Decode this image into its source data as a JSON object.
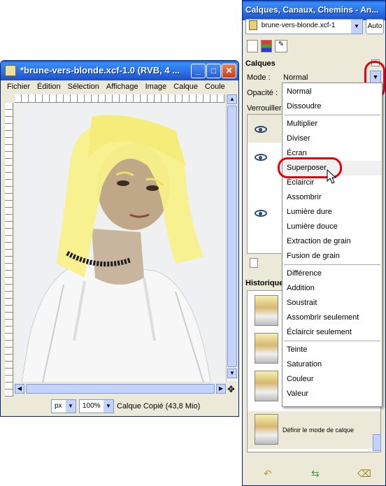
{
  "image_window": {
    "title": "*brune-vers-blonde.xcf-1.0 (RVB, 4 ...",
    "menu": [
      "Fichier",
      "Édition",
      "Sélection",
      "Affichage",
      "Image",
      "Calque",
      "Coule"
    ],
    "status": {
      "unit": "px",
      "zoom": "100%",
      "layer_info": "Calque Copié (43,8 Mio)"
    }
  },
  "dock": {
    "title": "Calques, Canaux, Chemins - An...",
    "image_select": "brune-vers-blonde.xcf-1",
    "auto_label": "Auto",
    "layers": {
      "heading": "Calques",
      "mode_label": "Mode :",
      "mode_value": "Normal",
      "opacity_label": "Opacité :",
      "lock_label": "Verrouiller :"
    },
    "history": {
      "heading": "Historique",
      "last_entry": "Définir le mode de calque"
    }
  },
  "mode_menu": {
    "groups": [
      [
        "Normal",
        "Dissoudre"
      ],
      [
        "Multiplier",
        "Diviser",
        "Écran",
        "Superposer",
        "Éclaircir",
        "Assombrir",
        "Lumière dure",
        "Lumière douce",
        "Extraction de grain",
        "Fusion de grain"
      ],
      [
        "Différence",
        "Addition",
        "Soustrait",
        "Assombrir seulement",
        "Éclaircir seulement"
      ],
      [
        "Teinte",
        "Saturation",
        "Couleur",
        "Valeur"
      ]
    ],
    "highlighted": "Superposer"
  },
  "colors": {
    "xp_blue": "#0a5de8",
    "annotation_red": "#e8000a",
    "hair_yellow": "#f8f08a"
  }
}
